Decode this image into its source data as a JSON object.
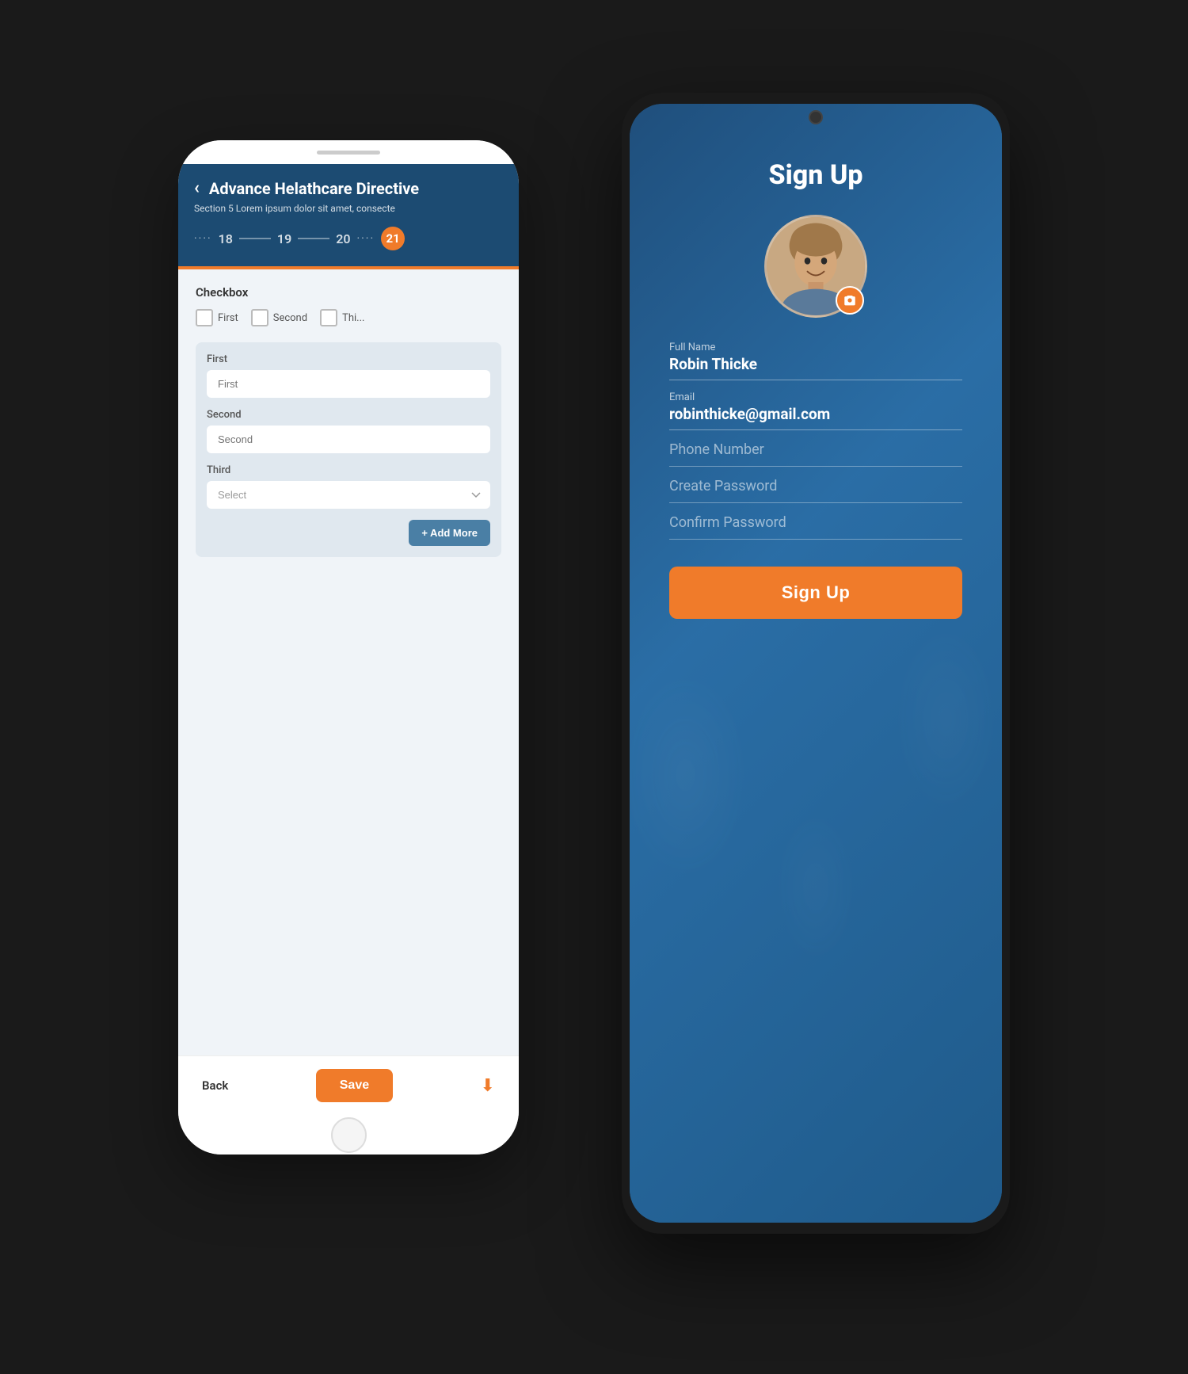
{
  "left_phone": {
    "header": {
      "back_label": "‹",
      "title": "Advance Helathcare Directive",
      "subtitle": "Section 5 Lorem ipsum dolor sit amet, consecte",
      "steps": {
        "step1": "18",
        "step2": "19",
        "step3": "20",
        "step_active": "21"
      }
    },
    "content": {
      "checkbox_section": {
        "label": "Checkbox",
        "items": [
          {
            "id": "first",
            "label": "First"
          },
          {
            "id": "second",
            "label": "Second"
          },
          {
            "id": "third",
            "label": "Thi..."
          }
        ]
      },
      "form_section": {
        "fields": [
          {
            "label": "First",
            "placeholder": "First",
            "type": "text"
          },
          {
            "label": "Second",
            "placeholder": "Second",
            "type": "text"
          },
          {
            "label": "Third",
            "placeholder": "Select",
            "type": "select"
          }
        ],
        "add_more_label": "+ Add More"
      }
    },
    "footer": {
      "back_label": "Back",
      "save_label": "Save",
      "download_icon": "⬇"
    }
  },
  "right_phone": {
    "title": "Sign Up",
    "avatar": {
      "camera_icon": "📷"
    },
    "form": {
      "full_name": {
        "label": "Full Name",
        "value": "Robin Thicke"
      },
      "email": {
        "label": "Email",
        "value": "robinthicke@gmail.com"
      },
      "phone_number": {
        "label": "Phone Number",
        "placeholder": "Phone Number"
      },
      "create_password": {
        "label": "",
        "placeholder": "Create Password"
      },
      "confirm_password": {
        "label": "",
        "placeholder": "Confirm Password"
      }
    },
    "signup_button_label": "Sign Up"
  }
}
